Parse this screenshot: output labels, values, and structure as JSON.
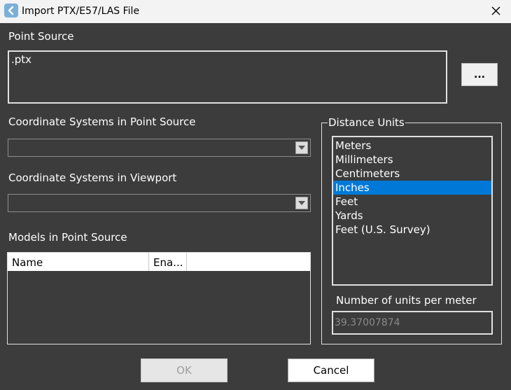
{
  "window": {
    "title": "Import PTX/E57/LAS File",
    "app_icon": "back-arrow-icon",
    "close_icon": "close-icon"
  },
  "point_source": {
    "label": "Point Source",
    "value": ".ptx",
    "browse_label": "..."
  },
  "coord_point_source": {
    "label": "Coordinate Systems in Point Source",
    "selected": ""
  },
  "coord_viewport": {
    "label": "Coordinate Systems in Viewport",
    "selected": ""
  },
  "models": {
    "label": "Models in Point Source",
    "columns": [
      "Name",
      "Ena..."
    ]
  },
  "distance_units": {
    "legend": "Distance Units",
    "options": [
      "Meters",
      "Millimeters",
      "Centimeters",
      "Inches",
      "Feet",
      "Yards",
      "Feet (U.S. Survey)"
    ],
    "selected": "Inches"
  },
  "units_per_meter": {
    "label": "Number of units per meter",
    "value": "39.37007874"
  },
  "buttons": {
    "ok": "OK",
    "cancel": "Cancel"
  },
  "colors": {
    "background": "#3c3c3c",
    "selection": "#0078d7",
    "titlebar": "#f3f3f3"
  }
}
